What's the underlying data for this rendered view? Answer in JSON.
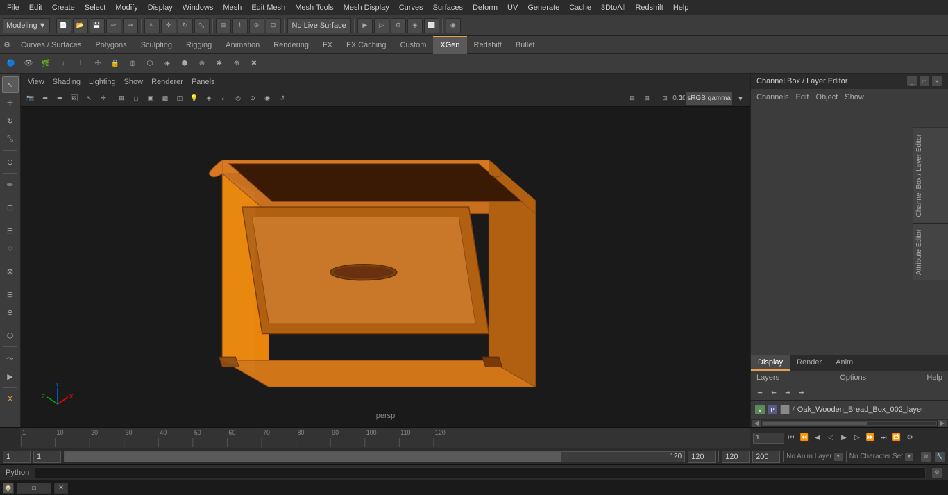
{
  "app": {
    "title": "Autodesk Maya"
  },
  "menu_bar": {
    "items": [
      "File",
      "Edit",
      "Create",
      "Select",
      "Modify",
      "Display",
      "Windows",
      "Mesh",
      "Edit Mesh",
      "Mesh Tools",
      "Mesh Display",
      "Curves",
      "Surfaces",
      "Deform",
      "UV",
      "Generate",
      "Cache",
      "3DtoAll",
      "Redshift",
      "Help"
    ]
  },
  "toolbar1": {
    "mode_dropdown": "Modeling",
    "live_surface_btn": "No Live Surface"
  },
  "tabs": {
    "items": [
      "Curves / Surfaces",
      "Polygons",
      "Sculpting",
      "Rigging",
      "Animation",
      "Rendering",
      "FX",
      "FX Caching",
      "Custom",
      "XGen",
      "Redshift",
      "Bullet"
    ],
    "active": "XGen"
  },
  "viewport": {
    "menus": [
      "View",
      "Shading",
      "Lighting",
      "Show",
      "Renderer",
      "Panels"
    ],
    "persp_label": "persp",
    "gamma": "sRGB gamma",
    "coords": {
      "x": "0.00",
      "y": "1.00"
    }
  },
  "channel_box": {
    "title": "Channel Box / Layer Editor",
    "menu_items": [
      "Channels",
      "Edit",
      "Object",
      "Show"
    ]
  },
  "layer_tabs": [
    "Display",
    "Render",
    "Anim"
  ],
  "layer_tabs_active": "Display",
  "layers_options": [
    "Layers",
    "Options",
    "Help"
  ],
  "layers": {
    "items": [
      {
        "v": "V",
        "p": "P",
        "pencil": "/",
        "name": "Oak_Wooden_Bread_Box_002_layer"
      }
    ]
  },
  "playback": {
    "start": "1",
    "end": "120",
    "current": "1",
    "range_start": "1",
    "range_end": "120",
    "max": "200"
  },
  "status_bar": {
    "anim_layer_label": "No Anim Layer",
    "char_set_label": "No Character Set"
  },
  "python_bar": {
    "label": "Python"
  },
  "bottom_window": {
    "title": ""
  }
}
